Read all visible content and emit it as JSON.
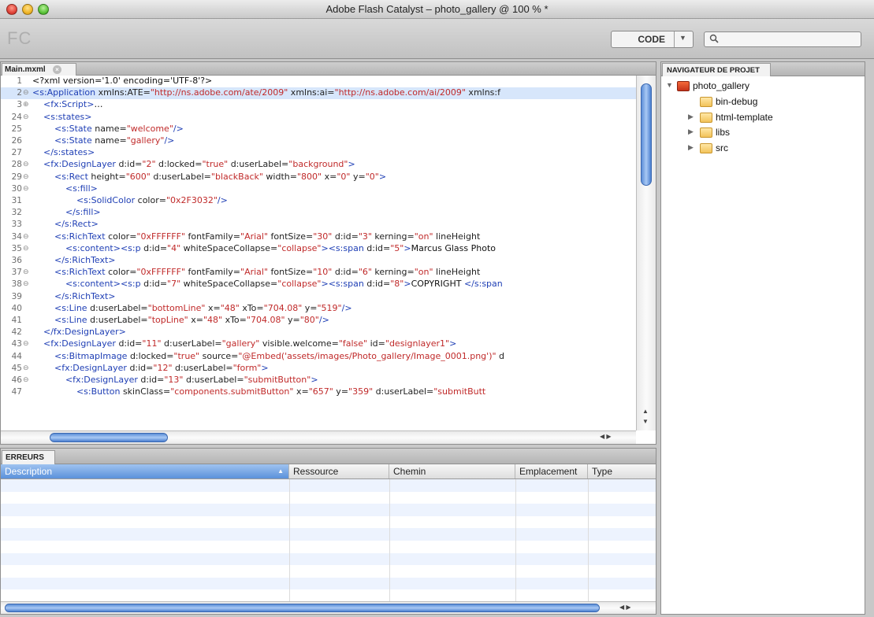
{
  "window": {
    "title": "Adobe Flash Catalyst – photo_gallery @ 100 % *"
  },
  "toolbar": {
    "logo": "FC",
    "mode_label": "CODE",
    "search_placeholder": ""
  },
  "editor": {
    "tab_label": "Main.mxml",
    "lines": [
      {
        "num": "1",
        "fold": "",
        "hl": false,
        "segs": [
          [
            "txt",
            "<?xml version='1.0' encoding='UTF-8'?>"
          ]
        ]
      },
      {
        "num": "2",
        "fold": "⊖",
        "hl": true,
        "segs": [
          [
            "tag",
            "<s:Application "
          ],
          [
            "attr",
            "xmlns:ATE="
          ],
          [
            "str",
            "\"http://ns.adobe.com/ate/2009\""
          ],
          [
            "attr",
            " xmlns:ai="
          ],
          [
            "str",
            "\"http://ns.adobe.com/ai/2009\""
          ],
          [
            "attr",
            " xmlns:f"
          ]
        ]
      },
      {
        "num": "3",
        "fold": "⊕",
        "hl": false,
        "segs": [
          [
            "txt",
            "    "
          ],
          [
            "tag",
            "<fx:Script>"
          ],
          [
            "txt",
            "…"
          ]
        ]
      },
      {
        "num": "24",
        "fold": "⊖",
        "hl": false,
        "segs": [
          [
            "txt",
            "    "
          ],
          [
            "tag",
            "<s:states>"
          ]
        ]
      },
      {
        "num": "25",
        "fold": "",
        "hl": false,
        "segs": [
          [
            "txt",
            "        "
          ],
          [
            "tag",
            "<s:State "
          ],
          [
            "attr",
            "name="
          ],
          [
            "str",
            "\"welcome\""
          ],
          [
            "tag",
            "/>"
          ]
        ]
      },
      {
        "num": "26",
        "fold": "",
        "hl": false,
        "segs": [
          [
            "txt",
            "        "
          ],
          [
            "tag",
            "<s:State "
          ],
          [
            "attr",
            "name="
          ],
          [
            "str",
            "\"gallery\""
          ],
          [
            "tag",
            "/>"
          ]
        ]
      },
      {
        "num": "27",
        "fold": "",
        "hl": false,
        "segs": [
          [
            "txt",
            "    "
          ],
          [
            "tag",
            "</s:states>"
          ]
        ]
      },
      {
        "num": "28",
        "fold": "⊖",
        "hl": false,
        "segs": [
          [
            "txt",
            "    "
          ],
          [
            "tag",
            "<fx:DesignLayer "
          ],
          [
            "attr",
            "d:id="
          ],
          [
            "str",
            "\"2\""
          ],
          [
            "attr",
            " d:locked="
          ],
          [
            "str",
            "\"true\""
          ],
          [
            "attr",
            " d:userLabel="
          ],
          [
            "str",
            "\"background\""
          ],
          [
            "tag",
            ">"
          ]
        ]
      },
      {
        "num": "29",
        "fold": "⊖",
        "hl": false,
        "segs": [
          [
            "txt",
            "        "
          ],
          [
            "tag",
            "<s:Rect "
          ],
          [
            "attr",
            "height="
          ],
          [
            "str",
            "\"600\""
          ],
          [
            "attr",
            " d:userLabel="
          ],
          [
            "str",
            "\"blackBack\""
          ],
          [
            "attr",
            " width="
          ],
          [
            "str",
            "\"800\""
          ],
          [
            "attr",
            " x="
          ],
          [
            "str",
            "\"0\""
          ],
          [
            "attr",
            " y="
          ],
          [
            "str",
            "\"0\""
          ],
          [
            "tag",
            ">"
          ]
        ]
      },
      {
        "num": "30",
        "fold": "⊖",
        "hl": false,
        "segs": [
          [
            "txt",
            "            "
          ],
          [
            "tag",
            "<s:fill>"
          ]
        ]
      },
      {
        "num": "31",
        "fold": "",
        "hl": false,
        "segs": [
          [
            "txt",
            "                "
          ],
          [
            "tag",
            "<s:SolidColor "
          ],
          [
            "attr",
            "color="
          ],
          [
            "str",
            "\"0x2F3032\""
          ],
          [
            "tag",
            "/>"
          ]
        ]
      },
      {
        "num": "32",
        "fold": "",
        "hl": false,
        "segs": [
          [
            "txt",
            "            "
          ],
          [
            "tag",
            "</s:fill>"
          ]
        ]
      },
      {
        "num": "33",
        "fold": "",
        "hl": false,
        "segs": [
          [
            "txt",
            "        "
          ],
          [
            "tag",
            "</s:Rect>"
          ]
        ]
      },
      {
        "num": "34",
        "fold": "⊖",
        "hl": false,
        "segs": [
          [
            "txt",
            "        "
          ],
          [
            "tag",
            "<s:RichText "
          ],
          [
            "attr",
            "color="
          ],
          [
            "str",
            "\"0xFFFFFF\""
          ],
          [
            "attr",
            " fontFamily="
          ],
          [
            "str",
            "\"Arial\""
          ],
          [
            "attr",
            " fontSize="
          ],
          [
            "str",
            "\"30\""
          ],
          [
            "attr",
            " d:id="
          ],
          [
            "str",
            "\"3\""
          ],
          [
            "attr",
            " kerning="
          ],
          [
            "str",
            "\"on\""
          ],
          [
            "attr",
            " lineHeight"
          ]
        ]
      },
      {
        "num": "35",
        "fold": "⊖",
        "hl": false,
        "segs": [
          [
            "txt",
            "            "
          ],
          [
            "tag",
            "<s:content><s:p "
          ],
          [
            "attr",
            "d:id="
          ],
          [
            "str",
            "\"4\""
          ],
          [
            "attr",
            " whiteSpaceCollapse="
          ],
          [
            "str",
            "\"collapse\""
          ],
          [
            "tag",
            "><s:span "
          ],
          [
            "attr",
            "d:id="
          ],
          [
            "str",
            "\"5\""
          ],
          [
            "tag",
            ">"
          ],
          [
            "txt",
            "Marcus Glass Photo"
          ]
        ]
      },
      {
        "num": "36",
        "fold": "",
        "hl": false,
        "segs": [
          [
            "txt",
            "        "
          ],
          [
            "tag",
            "</s:RichText>"
          ]
        ]
      },
      {
        "num": "37",
        "fold": "⊖",
        "hl": false,
        "segs": [
          [
            "txt",
            "        "
          ],
          [
            "tag",
            "<s:RichText "
          ],
          [
            "attr",
            "color="
          ],
          [
            "str",
            "\"0xFFFFFF\""
          ],
          [
            "attr",
            " fontFamily="
          ],
          [
            "str",
            "\"Arial\""
          ],
          [
            "attr",
            " fontSize="
          ],
          [
            "str",
            "\"10\""
          ],
          [
            "attr",
            " d:id="
          ],
          [
            "str",
            "\"6\""
          ],
          [
            "attr",
            " kerning="
          ],
          [
            "str",
            "\"on\""
          ],
          [
            "attr",
            " lineHeight"
          ]
        ]
      },
      {
        "num": "38",
        "fold": "⊖",
        "hl": false,
        "segs": [
          [
            "txt",
            "            "
          ],
          [
            "tag",
            "<s:content><s:p "
          ],
          [
            "attr",
            "d:id="
          ],
          [
            "str",
            "\"7\""
          ],
          [
            "attr",
            " whiteSpaceCollapse="
          ],
          [
            "str",
            "\"collapse\""
          ],
          [
            "tag",
            "><s:span "
          ],
          [
            "attr",
            "d:id="
          ],
          [
            "str",
            "\"8\""
          ],
          [
            "tag",
            ">"
          ],
          [
            "txt",
            "COPYRIGHT "
          ],
          [
            "tag",
            "</s:span"
          ]
        ]
      },
      {
        "num": "39",
        "fold": "",
        "hl": false,
        "segs": [
          [
            "txt",
            "        "
          ],
          [
            "tag",
            "</s:RichText>"
          ]
        ]
      },
      {
        "num": "40",
        "fold": "",
        "hl": false,
        "segs": [
          [
            "txt",
            "        "
          ],
          [
            "tag",
            "<s:Line "
          ],
          [
            "attr",
            "d:userLabel="
          ],
          [
            "str",
            "\"bottomLine\""
          ],
          [
            "attr",
            " x="
          ],
          [
            "str",
            "\"48\""
          ],
          [
            "attr",
            " xTo="
          ],
          [
            "str",
            "\"704.08\""
          ],
          [
            "attr",
            " y="
          ],
          [
            "str",
            "\"519\""
          ],
          [
            "tag",
            "/>"
          ]
        ]
      },
      {
        "num": "41",
        "fold": "",
        "hl": false,
        "segs": [
          [
            "txt",
            "        "
          ],
          [
            "tag",
            "<s:Line "
          ],
          [
            "attr",
            "d:userLabel="
          ],
          [
            "str",
            "\"topLine\""
          ],
          [
            "attr",
            " x="
          ],
          [
            "str",
            "\"48\""
          ],
          [
            "attr",
            " xTo="
          ],
          [
            "str",
            "\"704.08\""
          ],
          [
            "attr",
            " y="
          ],
          [
            "str",
            "\"80\""
          ],
          [
            "tag",
            "/>"
          ]
        ]
      },
      {
        "num": "42",
        "fold": "",
        "hl": false,
        "segs": [
          [
            "txt",
            "    "
          ],
          [
            "tag",
            "</fx:DesignLayer>"
          ]
        ]
      },
      {
        "num": "43",
        "fold": "⊖",
        "hl": false,
        "segs": [
          [
            "txt",
            "    "
          ],
          [
            "tag",
            "<fx:DesignLayer "
          ],
          [
            "attr",
            "d:id="
          ],
          [
            "str",
            "\"11\""
          ],
          [
            "attr",
            " d:userLabel="
          ],
          [
            "str",
            "\"gallery\""
          ],
          [
            "attr",
            " visible.welcome="
          ],
          [
            "str",
            "\"false\""
          ],
          [
            "attr",
            " id="
          ],
          [
            "str",
            "\"designlayer1\""
          ],
          [
            "tag",
            ">"
          ]
        ]
      },
      {
        "num": "44",
        "fold": "",
        "hl": false,
        "segs": [
          [
            "txt",
            "        "
          ],
          [
            "tag",
            "<s:BitmapImage "
          ],
          [
            "attr",
            "d:locked="
          ],
          [
            "str",
            "\"true\""
          ],
          [
            "attr",
            " source="
          ],
          [
            "str",
            "\"@Embed('assets/images/Photo_gallery/Image_0001.png')\""
          ],
          [
            "attr",
            " d"
          ]
        ]
      },
      {
        "num": "45",
        "fold": "⊖",
        "hl": false,
        "segs": [
          [
            "txt",
            "        "
          ],
          [
            "tag",
            "<fx:DesignLayer "
          ],
          [
            "attr",
            "d:id="
          ],
          [
            "str",
            "\"12\""
          ],
          [
            "attr",
            " d:userLabel="
          ],
          [
            "str",
            "\"form\""
          ],
          [
            "tag",
            ">"
          ]
        ]
      },
      {
        "num": "46",
        "fold": "⊖",
        "hl": false,
        "segs": [
          [
            "txt",
            "            "
          ],
          [
            "tag",
            "<fx:DesignLayer "
          ],
          [
            "attr",
            "d:id="
          ],
          [
            "str",
            "\"13\""
          ],
          [
            "attr",
            " d:userLabel="
          ],
          [
            "str",
            "\"submitButton\""
          ],
          [
            "tag",
            ">"
          ]
        ]
      },
      {
        "num": "47",
        "fold": "",
        "hl": false,
        "segs": [
          [
            "txt",
            "                "
          ],
          [
            "tag",
            "<s:Button "
          ],
          [
            "attr",
            "skinClass="
          ],
          [
            "str",
            "\"components.submitButton\""
          ],
          [
            "attr",
            " x="
          ],
          [
            "str",
            "\"657\""
          ],
          [
            "attr",
            " y="
          ],
          [
            "str",
            "\"359\""
          ],
          [
            "attr",
            " d:userLabel="
          ],
          [
            "str",
            "\"submitButt"
          ]
        ]
      }
    ]
  },
  "errors": {
    "tab_label": "ERREURS",
    "columns": [
      "Description",
      "Ressource",
      "Chemin",
      "Emplacement",
      "Type"
    ],
    "row_count": 10
  },
  "navigator": {
    "tab_label": "NAVIGATEUR DE PROJET",
    "project": "photo_gallery",
    "items": [
      {
        "label": "bin-debug",
        "expandable": false
      },
      {
        "label": "html-template",
        "expandable": true
      },
      {
        "label": "libs",
        "expandable": true
      },
      {
        "label": "src",
        "expandable": true
      }
    ]
  },
  "colors": {
    "tag": "#1f3fb5",
    "string": "#c02a2a",
    "highlight": "#d7e6fb",
    "accent": "#5b91db"
  }
}
